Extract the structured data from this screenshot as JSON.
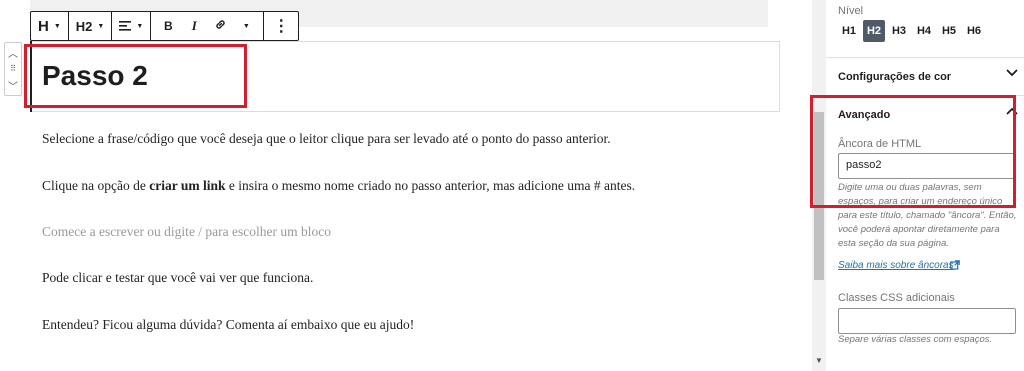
{
  "toolbar": {
    "block_type": "H",
    "heading_level": "H2",
    "align_icon": "align-left-icon",
    "bold": "B",
    "italic": "I",
    "link_icon": "link-icon",
    "more": "⋮"
  },
  "block": {
    "heading_text": "Passo 2"
  },
  "content": {
    "p1": "Selecione a frase/código que você deseja que o leitor clique para ser levado até o ponto do passo anterior.",
    "p2_pre": "Clique na opção de ",
    "p2_bold": "criar um link",
    "p2_post": " e insira o mesmo nome criado no passo anterior, mas adicione uma # antes.",
    "placeholder": "Comece a escrever ou digite / para escolher um bloco",
    "p3": "Pode clicar e testar que você vai ver que funciona.",
    "p4": "Entendeu? Ficou alguma dúvida? Comenta aí embaixo que eu ajudo!"
  },
  "sidebar": {
    "level_label": "Nível",
    "levels": [
      "H1",
      "H2",
      "H3",
      "H4",
      "H5",
      "H6"
    ],
    "active_level": "H2",
    "color_settings": "Configurações de cor",
    "advanced": "Avançado",
    "anchor_label": "Âncora de HTML",
    "anchor_value": "passo2",
    "anchor_help": "Digite uma ou duas palavras, sem espaços, para criar um endereço único para este título, chamado \"âncora\". Então, você poderá apontar diretamente para esta seção da sua página.",
    "learn_more": "Saiba mais sobre âncoras",
    "css_label": "Classes CSS adicionais",
    "css_value": "",
    "css_help": "Separe várias classes com espaços."
  },
  "colors": {
    "highlight": "#d21f2e",
    "active_level_bg": "#505b68",
    "link": "#2271b1"
  }
}
